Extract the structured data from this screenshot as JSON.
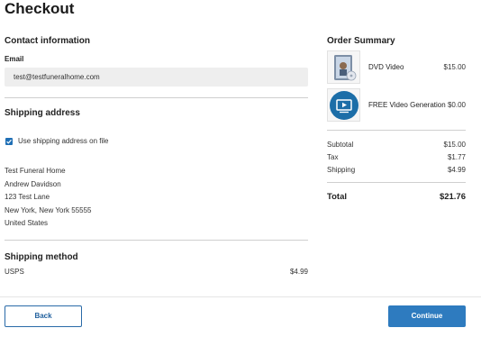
{
  "page": {
    "title": "Checkout"
  },
  "contact": {
    "heading": "Contact information",
    "email_label": "Email",
    "email_value": "test@testfuneralhome.com"
  },
  "shipping_address": {
    "heading": "Shipping address",
    "checkbox_label": "Use shipping address on file",
    "checkbox_checked": true,
    "lines": [
      "Test Funeral Home",
      "Andrew Davidson",
      "123 Test Lane",
      "New York, New York 55555",
      "United States"
    ]
  },
  "shipping_method": {
    "heading": "Shipping method",
    "name": "USPS",
    "price": "$4.99"
  },
  "summary": {
    "heading": "Order Summary",
    "items": [
      {
        "name": "DVD Video",
        "price": "$15.00",
        "icon": "dvd-case-icon"
      },
      {
        "name": "FREE Video Generation",
        "price": "$0.00",
        "icon": "video-play-icon"
      }
    ],
    "subtotal_label": "Subtotal",
    "subtotal": "$15.00",
    "tax_label": "Tax",
    "tax": "$1.77",
    "shipping_label": "Shipping",
    "shipping": "$4.99",
    "total_label": "Total",
    "total": "$21.76"
  },
  "buttons": {
    "back": "Back",
    "continue": "Continue"
  },
  "colors": {
    "accent": "#2e7bbf",
    "checkbox": "#1f6fb5",
    "input_bg": "#eeeeee",
    "divider": "#cfcfcf"
  }
}
